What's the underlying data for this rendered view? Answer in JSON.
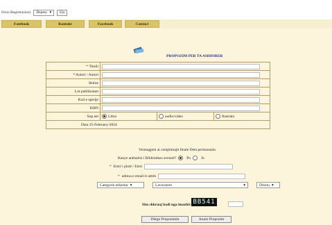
{
  "top": {
    "search_label": "Iirsio Registrazioni",
    "search_select": "Depesc",
    "search_button": "Go"
  },
  "nav": {
    "tabs": [
      "Fatebook",
      "Kontakt",
      "Facebook",
      "Contact"
    ]
  },
  "form": {
    "title": "Propozim Per Ta Ashiorer",
    "rows": [
      {
        "label": "Titulli",
        "required": true
      },
      {
        "label": "Autori / Autori",
        "required": true
      },
      {
        "label": "Ilstrue",
        "required": false
      },
      {
        "label": "Lot publikoinet",
        "required": false
      },
      {
        "label": "Kod e sperije",
        "required": false
      },
      {
        "label": "ISBN",
        "required": false
      }
    ],
    "type_label": "Sup eet",
    "type_options": [
      "Libra",
      "audio/video",
      "Ilustrato"
    ],
    "type_selected": 0,
    "date_text": "Data 25-February-2024",
    "note": "Vermagjem ai cemplimajit fmale Deta perisuonalu",
    "member_question": "Kanye anëtarësi i Bibliotekes avetarë?",
    "member_options": [
      "Po",
      "Jo"
    ],
    "member_selected": 0,
    "name_label": "Emri i plotë / Emri",
    "email_label": "adresa e email-it adrës",
    "dropdowns": [
      "Categorie etikettar",
      "Lavoratore",
      "Ditsitu"
    ],
    "captcha_label": "Sito shkruaj kodi nga imazhë:",
    "captcha_text": "BB541",
    "submit_label": "Dërgo Propozimin",
    "reset_label": "Anulo Propozim"
  },
  "colors": {
    "page_bg": "#fdf4dc",
    "tab_bg": "#d9c46a",
    "title": "#2b2b6b"
  }
}
